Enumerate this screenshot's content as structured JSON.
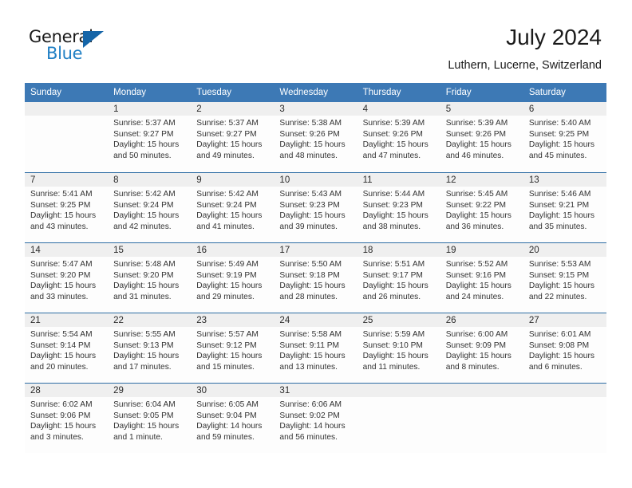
{
  "brand": {
    "name_part1": "General",
    "name_part2": "Blue",
    "triangle_color": "#1565a8",
    "blue_text_color": "#1f7fc4"
  },
  "header": {
    "title": "July 2024",
    "subtitle": "Luthern, Lucerne, Switzerland"
  },
  "theme": {
    "header_bar_color": "#3d79b5",
    "row_rule_color": "#2e6da4",
    "daynum_band_color": "#efefef"
  },
  "weekdays": [
    "Sunday",
    "Monday",
    "Tuesday",
    "Wednesday",
    "Thursday",
    "Friday",
    "Saturday"
  ],
  "weeks": [
    [
      {
        "day": "",
        "sunrise": "",
        "sunset": "",
        "daylight_line1": "",
        "daylight_line2": "",
        "empty": true
      },
      {
        "day": "1",
        "sunrise": "Sunrise: 5:37 AM",
        "sunset": "Sunset: 9:27 PM",
        "daylight_line1": "Daylight: 15 hours",
        "daylight_line2": "and 50 minutes."
      },
      {
        "day": "2",
        "sunrise": "Sunrise: 5:37 AM",
        "sunset": "Sunset: 9:27 PM",
        "daylight_line1": "Daylight: 15 hours",
        "daylight_line2": "and 49 minutes."
      },
      {
        "day": "3",
        "sunrise": "Sunrise: 5:38 AM",
        "sunset": "Sunset: 9:26 PM",
        "daylight_line1": "Daylight: 15 hours",
        "daylight_line2": "and 48 minutes."
      },
      {
        "day": "4",
        "sunrise": "Sunrise: 5:39 AM",
        "sunset": "Sunset: 9:26 PM",
        "daylight_line1": "Daylight: 15 hours",
        "daylight_line2": "and 47 minutes."
      },
      {
        "day": "5",
        "sunrise": "Sunrise: 5:39 AM",
        "sunset": "Sunset: 9:26 PM",
        "daylight_line1": "Daylight: 15 hours",
        "daylight_line2": "and 46 minutes."
      },
      {
        "day": "6",
        "sunrise": "Sunrise: 5:40 AM",
        "sunset": "Sunset: 9:25 PM",
        "daylight_line1": "Daylight: 15 hours",
        "daylight_line2": "and 45 minutes."
      }
    ],
    [
      {
        "day": "7",
        "sunrise": "Sunrise: 5:41 AM",
        "sunset": "Sunset: 9:25 PM",
        "daylight_line1": "Daylight: 15 hours",
        "daylight_line2": "and 43 minutes."
      },
      {
        "day": "8",
        "sunrise": "Sunrise: 5:42 AM",
        "sunset": "Sunset: 9:24 PM",
        "daylight_line1": "Daylight: 15 hours",
        "daylight_line2": "and 42 minutes."
      },
      {
        "day": "9",
        "sunrise": "Sunrise: 5:42 AM",
        "sunset": "Sunset: 9:24 PM",
        "daylight_line1": "Daylight: 15 hours",
        "daylight_line2": "and 41 minutes."
      },
      {
        "day": "10",
        "sunrise": "Sunrise: 5:43 AM",
        "sunset": "Sunset: 9:23 PM",
        "daylight_line1": "Daylight: 15 hours",
        "daylight_line2": "and 39 minutes."
      },
      {
        "day": "11",
        "sunrise": "Sunrise: 5:44 AM",
        "sunset": "Sunset: 9:23 PM",
        "daylight_line1": "Daylight: 15 hours",
        "daylight_line2": "and 38 minutes."
      },
      {
        "day": "12",
        "sunrise": "Sunrise: 5:45 AM",
        "sunset": "Sunset: 9:22 PM",
        "daylight_line1": "Daylight: 15 hours",
        "daylight_line2": "and 36 minutes."
      },
      {
        "day": "13",
        "sunrise": "Sunrise: 5:46 AM",
        "sunset": "Sunset: 9:21 PM",
        "daylight_line1": "Daylight: 15 hours",
        "daylight_line2": "and 35 minutes."
      }
    ],
    [
      {
        "day": "14",
        "sunrise": "Sunrise: 5:47 AM",
        "sunset": "Sunset: 9:20 PM",
        "daylight_line1": "Daylight: 15 hours",
        "daylight_line2": "and 33 minutes."
      },
      {
        "day": "15",
        "sunrise": "Sunrise: 5:48 AM",
        "sunset": "Sunset: 9:20 PM",
        "daylight_line1": "Daylight: 15 hours",
        "daylight_line2": "and 31 minutes."
      },
      {
        "day": "16",
        "sunrise": "Sunrise: 5:49 AM",
        "sunset": "Sunset: 9:19 PM",
        "daylight_line1": "Daylight: 15 hours",
        "daylight_line2": "and 29 minutes."
      },
      {
        "day": "17",
        "sunrise": "Sunrise: 5:50 AM",
        "sunset": "Sunset: 9:18 PM",
        "daylight_line1": "Daylight: 15 hours",
        "daylight_line2": "and 28 minutes."
      },
      {
        "day": "18",
        "sunrise": "Sunrise: 5:51 AM",
        "sunset": "Sunset: 9:17 PM",
        "daylight_line1": "Daylight: 15 hours",
        "daylight_line2": "and 26 minutes."
      },
      {
        "day": "19",
        "sunrise": "Sunrise: 5:52 AM",
        "sunset": "Sunset: 9:16 PM",
        "daylight_line1": "Daylight: 15 hours",
        "daylight_line2": "and 24 minutes."
      },
      {
        "day": "20",
        "sunrise": "Sunrise: 5:53 AM",
        "sunset": "Sunset: 9:15 PM",
        "daylight_line1": "Daylight: 15 hours",
        "daylight_line2": "and 22 minutes."
      }
    ],
    [
      {
        "day": "21",
        "sunrise": "Sunrise: 5:54 AM",
        "sunset": "Sunset: 9:14 PM",
        "daylight_line1": "Daylight: 15 hours",
        "daylight_line2": "and 20 minutes."
      },
      {
        "day": "22",
        "sunrise": "Sunrise: 5:55 AM",
        "sunset": "Sunset: 9:13 PM",
        "daylight_line1": "Daylight: 15 hours",
        "daylight_line2": "and 17 minutes."
      },
      {
        "day": "23",
        "sunrise": "Sunrise: 5:57 AM",
        "sunset": "Sunset: 9:12 PM",
        "daylight_line1": "Daylight: 15 hours",
        "daylight_line2": "and 15 minutes."
      },
      {
        "day": "24",
        "sunrise": "Sunrise: 5:58 AM",
        "sunset": "Sunset: 9:11 PM",
        "daylight_line1": "Daylight: 15 hours",
        "daylight_line2": "and 13 minutes."
      },
      {
        "day": "25",
        "sunrise": "Sunrise: 5:59 AM",
        "sunset": "Sunset: 9:10 PM",
        "daylight_line1": "Daylight: 15 hours",
        "daylight_line2": "and 11 minutes."
      },
      {
        "day": "26",
        "sunrise": "Sunrise: 6:00 AM",
        "sunset": "Sunset: 9:09 PM",
        "daylight_line1": "Daylight: 15 hours",
        "daylight_line2": "and 8 minutes."
      },
      {
        "day": "27",
        "sunrise": "Sunrise: 6:01 AM",
        "sunset": "Sunset: 9:08 PM",
        "daylight_line1": "Daylight: 15 hours",
        "daylight_line2": "and 6 minutes."
      }
    ],
    [
      {
        "day": "28",
        "sunrise": "Sunrise: 6:02 AM",
        "sunset": "Sunset: 9:06 PM",
        "daylight_line1": "Daylight: 15 hours",
        "daylight_line2": "and 3 minutes."
      },
      {
        "day": "29",
        "sunrise": "Sunrise: 6:04 AM",
        "sunset": "Sunset: 9:05 PM",
        "daylight_line1": "Daylight: 15 hours",
        "daylight_line2": "and 1 minute."
      },
      {
        "day": "30",
        "sunrise": "Sunrise: 6:05 AM",
        "sunset": "Sunset: 9:04 PM",
        "daylight_line1": "Daylight: 14 hours",
        "daylight_line2": "and 59 minutes."
      },
      {
        "day": "31",
        "sunrise": "Sunrise: 6:06 AM",
        "sunset": "Sunset: 9:02 PM",
        "daylight_line1": "Daylight: 14 hours",
        "daylight_line2": "and 56 minutes."
      },
      {
        "day": "",
        "sunrise": "",
        "sunset": "",
        "daylight_line1": "",
        "daylight_line2": "",
        "empty": true
      },
      {
        "day": "",
        "sunrise": "",
        "sunset": "",
        "daylight_line1": "",
        "daylight_line2": "",
        "empty": true
      },
      {
        "day": "",
        "sunrise": "",
        "sunset": "",
        "daylight_line1": "",
        "daylight_line2": "",
        "empty": true
      }
    ]
  ]
}
